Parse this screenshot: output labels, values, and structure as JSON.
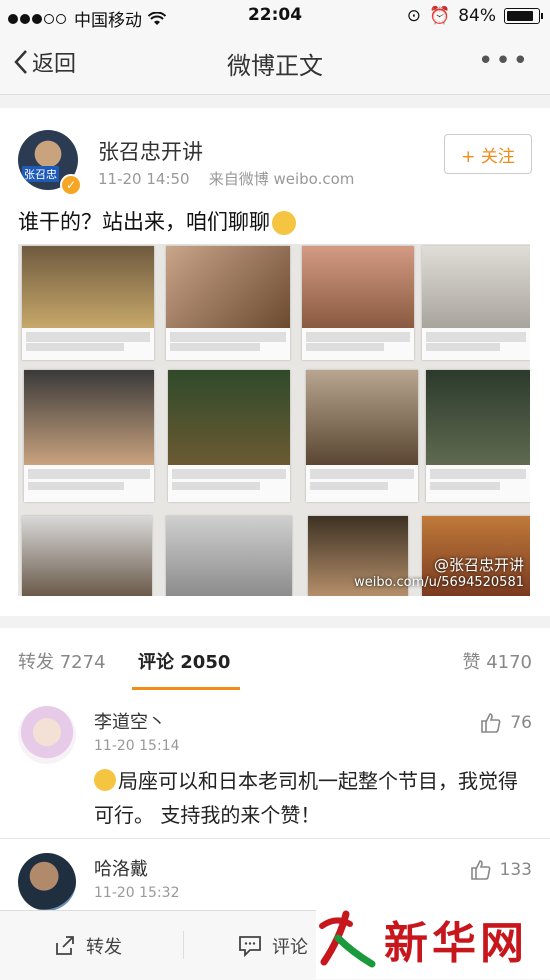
{
  "status_bar": {
    "carrier": "中国移动",
    "time": "22:04",
    "battery": "84%"
  },
  "nav": {
    "back_label": "返回",
    "title": "微博正文",
    "more_label": "•••"
  },
  "post": {
    "author": "张召忠开讲",
    "avatar_tag": "张召忠",
    "timestamp": "11-20 14:50",
    "source": "来自微博 weibo.com",
    "follow_label": "+ 关注",
    "text": "谁干的？站出来，咱们聊聊",
    "image_watermark": {
      "name": "@张召忠开讲",
      "url": "weibo.com/u/5694520581"
    }
  },
  "tabs": [
    {
      "label": "转发 7274"
    },
    {
      "label": "评论 2050"
    },
    {
      "label": "赞 4170"
    }
  ],
  "comments": [
    {
      "name": "李道空丶",
      "time": "11-20 15:14",
      "likes": "76",
      "text": "局座可以和日本老司机一起整个节目，我觉得可行。 支持我的来个赞！"
    },
    {
      "name": "哈洛戴",
      "time": "11-20 15:32",
      "likes": "133",
      "text": ""
    }
  ],
  "toolbar": {
    "repost_label": "转发",
    "comment_label": "评论"
  },
  "brand": {
    "logo_text": "新华网"
  },
  "colors": {
    "accent": "#f08c17",
    "verified": "#f5a623",
    "brand_red": "#c8161d"
  }
}
